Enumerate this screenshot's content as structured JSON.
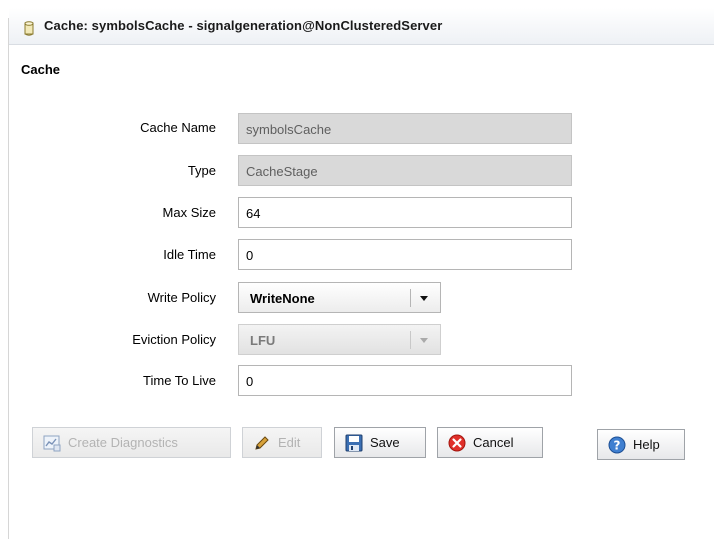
{
  "window": {
    "title": "Cache: symbolsCache - signalgeneration@NonClusteredServer"
  },
  "section": {
    "title": "Cache"
  },
  "form": {
    "cache_name": {
      "label": "Cache Name",
      "value": "symbolsCache"
    },
    "type": {
      "label": "Type",
      "value": "CacheStage"
    },
    "max_size": {
      "label": "Max Size",
      "value": "64"
    },
    "idle_time": {
      "label": "Idle Time",
      "value": "0"
    },
    "write_policy": {
      "label": "Write Policy",
      "value": "WriteNone"
    },
    "eviction_policy": {
      "label": "Eviction Policy",
      "value": "LFU"
    },
    "time_to_live": {
      "label": "Time To Live",
      "value": "0"
    }
  },
  "buttons": {
    "create_diagnostics": "Create Diagnostics",
    "edit": "Edit",
    "save": "Save",
    "cancel": "Cancel",
    "help": "Help"
  }
}
